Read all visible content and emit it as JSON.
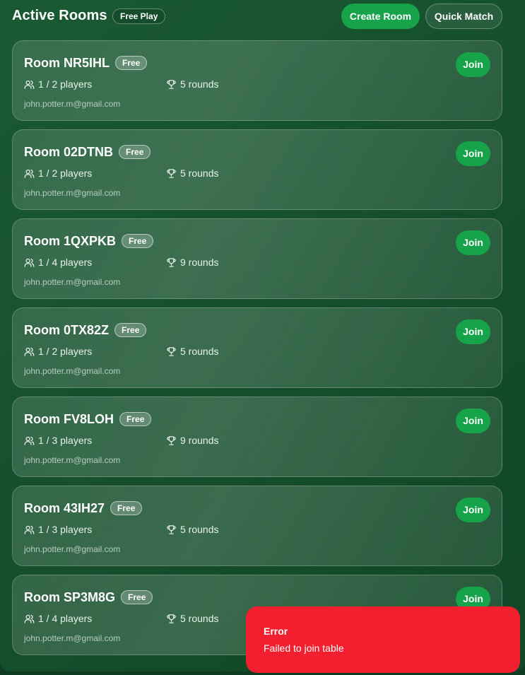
{
  "header": {
    "title": "Active Rooms",
    "mode_badge": "Free Play",
    "create_label": "Create Room",
    "quick_label": "Quick Match"
  },
  "rooms": [
    {
      "name": "Room NR5IHL",
      "badge": "Free",
      "players": "1 / 2 players",
      "rounds": "5 rounds",
      "email": "john.potter.m@gmail.com",
      "join_label": "Join"
    },
    {
      "name": "Room 02DTNB",
      "badge": "Free",
      "players": "1 / 2 players",
      "rounds": "5 rounds",
      "email": "john.potter.m@gmail.com",
      "join_label": "Join"
    },
    {
      "name": "Room 1QXPKB",
      "badge": "Free",
      "players": "1 / 4 players",
      "rounds": "9 rounds",
      "email": "john.potter.m@gmail.com",
      "join_label": "Join"
    },
    {
      "name": "Room 0TX82Z",
      "badge": "Free",
      "players": "1 / 2 players",
      "rounds": "5 rounds",
      "email": "john.potter.m@gmail.com",
      "join_label": "Join"
    },
    {
      "name": "Room FV8LOH",
      "badge": "Free",
      "players": "1 / 3 players",
      "rounds": "9 rounds",
      "email": "john.potter.m@gmail.com",
      "join_label": "Join"
    },
    {
      "name": "Room 43IH27",
      "badge": "Free",
      "players": "1 / 3 players",
      "rounds": "5 rounds",
      "email": "john.potter.m@gmail.com",
      "join_label": "Join"
    },
    {
      "name": "Room SP3M8G",
      "badge": "Free",
      "players": "1 / 4 players",
      "rounds": "5 rounds",
      "email": "john.potter.m@gmail.com",
      "join_label": "Join"
    }
  ],
  "icons": {
    "players": "users-icon",
    "rounds": "trophy-icon"
  },
  "colors": {
    "accent": "#16a34a",
    "error": "#f2202f",
    "background": "#16502d"
  },
  "toast": {
    "title": "Error",
    "message": "Failed to join table"
  }
}
